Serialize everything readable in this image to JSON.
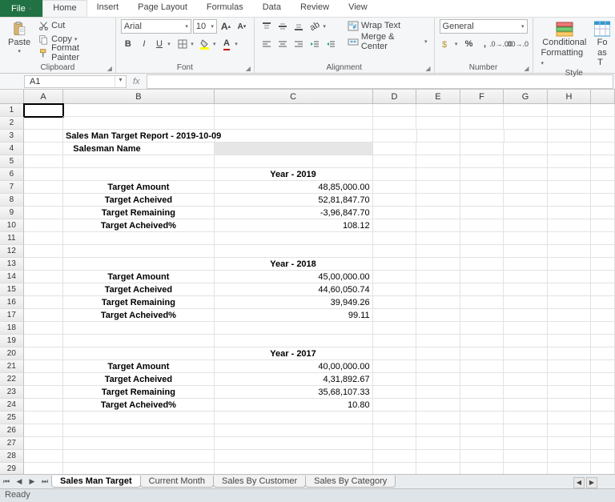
{
  "tabs": {
    "file": "File",
    "home": "Home",
    "insert": "Insert",
    "page": "Page Layout",
    "formulas": "Formulas",
    "data": "Data",
    "review": "Review",
    "view": "View"
  },
  "clipboard": {
    "paste": "Paste",
    "cut": "Cut",
    "copy": "Copy",
    "fmt": "Format Painter",
    "group": "Clipboard"
  },
  "font": {
    "name": "Arial",
    "size": "10",
    "group": "Font"
  },
  "align": {
    "wrap": "Wrap Text",
    "merge": "Merge & Center",
    "group": "Alignment"
  },
  "number": {
    "format": "General",
    "group": "Number"
  },
  "styles": {
    "cond": "Conditional",
    "condfmt": "Formatting",
    "as": "Fo",
    "ast": "as T",
    "group": "Style"
  },
  "namebox": "A1",
  "fx": "fx",
  "cols": [
    "A",
    "B",
    "C",
    "D",
    "E",
    "F",
    "G",
    "H"
  ],
  "report": {
    "title": "Sales Man Target Report - 2019-10-09",
    "salesman_label": "Salesman Name",
    "y2019": {
      "header": "Year - 2019",
      "labels": {
        "ta": "Target Amount",
        "tach": "Target Acheived",
        "tr": "Target Remaining",
        "tp": "Target Acheived%"
      },
      "vals": {
        "ta": "48,85,000.00",
        "tach": "52,81,847.70",
        "tr": "-3,96,847.70",
        "tp": "108.12"
      }
    },
    "y2018": {
      "header": "Year - 2018",
      "labels": {
        "ta": "Target Amount",
        "tach": "Target Acheived",
        "tr": "Target Remaining",
        "tp": "Target Acheived%"
      },
      "vals": {
        "ta": "45,00,000.00",
        "tach": "44,60,050.74",
        "tr": "39,949.26",
        "tp": "99.11"
      }
    },
    "y2017": {
      "header": "Year - 2017",
      "labels": {
        "ta": "Target Amount",
        "tach": "Target Acheived",
        "tr": "Target Remaining",
        "tp": "Target Acheived%"
      },
      "vals": {
        "ta": "40,00,000.00",
        "tach": "4,31,892.67",
        "tr": "35,68,107.33",
        "tp": "10.80"
      }
    }
  },
  "sheets": {
    "s1": "Sales Man Target",
    "s2": "Current Month",
    "s3": "Sales By Customer",
    "s4": "Sales By Category"
  },
  "status": "Ready"
}
